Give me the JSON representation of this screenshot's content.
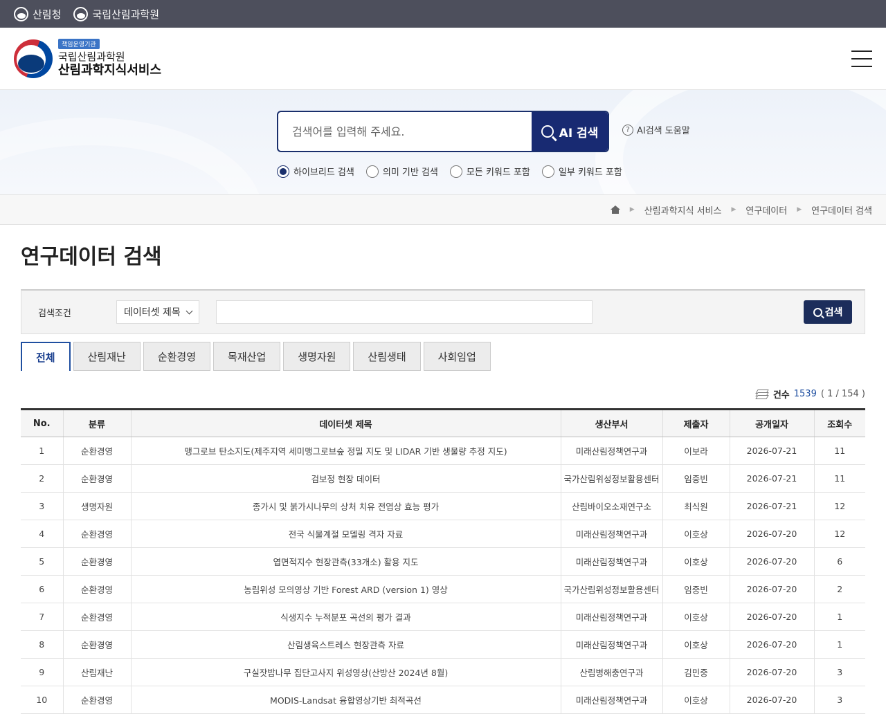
{
  "topbar": {
    "links": [
      "산림청",
      "국립산림과학원"
    ]
  },
  "header": {
    "badge": "책임운영기관",
    "org": "국립산림과학원",
    "service": "산림과학지식서비스"
  },
  "search": {
    "placeholder": "검색어를 입력해 주세요.",
    "button": "AI 검색",
    "help": "AI검색 도움말",
    "modes": [
      "하이브리드 검색",
      "의미 기반 검색",
      "모든 키워드 포함",
      "일부 키워드 포함"
    ],
    "selected_mode": "하이브리드 검색"
  },
  "breadcrumb": [
    "산림과학지식 서비스",
    "연구데이터",
    "연구데이터 검색"
  ],
  "page": {
    "title": "연구데이터 검색"
  },
  "condition": {
    "label": "검색조건",
    "select_value": "데이터셋 제목",
    "button": "검색"
  },
  "tabs": [
    "전체",
    "산림재난",
    "순환경영",
    "목재산업",
    "생명자원",
    "산림생태",
    "사회임업"
  ],
  "active_tab": "전체",
  "count": {
    "label": "건수",
    "total": "1539",
    "page": "( 1 / 154 )"
  },
  "table": {
    "headers": [
      "No.",
      "분류",
      "데이터셋 제목",
      "생산부서",
      "제출자",
      "공개일자",
      "조회수"
    ],
    "rows": [
      [
        "1",
        "순환경영",
        "맹그로브 탄소지도(제주지역 세미맹그로브숲 정밀 지도 및 LIDAR 기반 생물량 추정 지도)",
        "미래산림정책연구과",
        "이보라",
        "2026-07-21",
        "11"
      ],
      [
        "2",
        "순환경영",
        "검보정 현장 데이터",
        "국가산림위성정보활용센터",
        "임중빈",
        "2026-07-21",
        "11"
      ],
      [
        "3",
        "생명자원",
        "종가시 및 붉가시나무의 상처 치유 전엽상 효능 평가",
        "산림바이오소재연구소",
        "최식원",
        "2026-07-21",
        "12"
      ],
      [
        "4",
        "순환경영",
        "전국 식물계절 모델링 격자 자료",
        "미래산림정책연구과",
        "이호상",
        "2026-07-20",
        "12"
      ],
      [
        "5",
        "순환경영",
        "엽면적지수 현장관측(33개소) 활용 지도",
        "미래산림정책연구과",
        "이호상",
        "2026-07-20",
        "6"
      ],
      [
        "6",
        "순환경영",
        "농림위성 모의영상 기반 Forest ARD (version 1) 영상",
        "국가산림위성정보활용센터",
        "임중빈",
        "2026-07-20",
        "2"
      ],
      [
        "7",
        "순환경영",
        "식생지수 누적분포 곡선의 평가 결과",
        "미래산림정책연구과",
        "이호상",
        "2026-07-20",
        "1"
      ],
      [
        "8",
        "순환경영",
        "산림생육스트레스 현장관측 자료",
        "미래산림정책연구과",
        "이호상",
        "2026-07-20",
        "1"
      ],
      [
        "9",
        "산림재난",
        "구실잣밤나무 집단고사지 위성영상(산방산 2024년 8월)",
        "산림병해충연구과",
        "김민중",
        "2026-07-20",
        "3"
      ],
      [
        "10",
        "순환경영",
        "MODIS-Landsat 융합영상기반 최적곡선",
        "미래산림정책연구과",
        "이호상",
        "2026-07-20",
        "3"
      ]
    ]
  }
}
